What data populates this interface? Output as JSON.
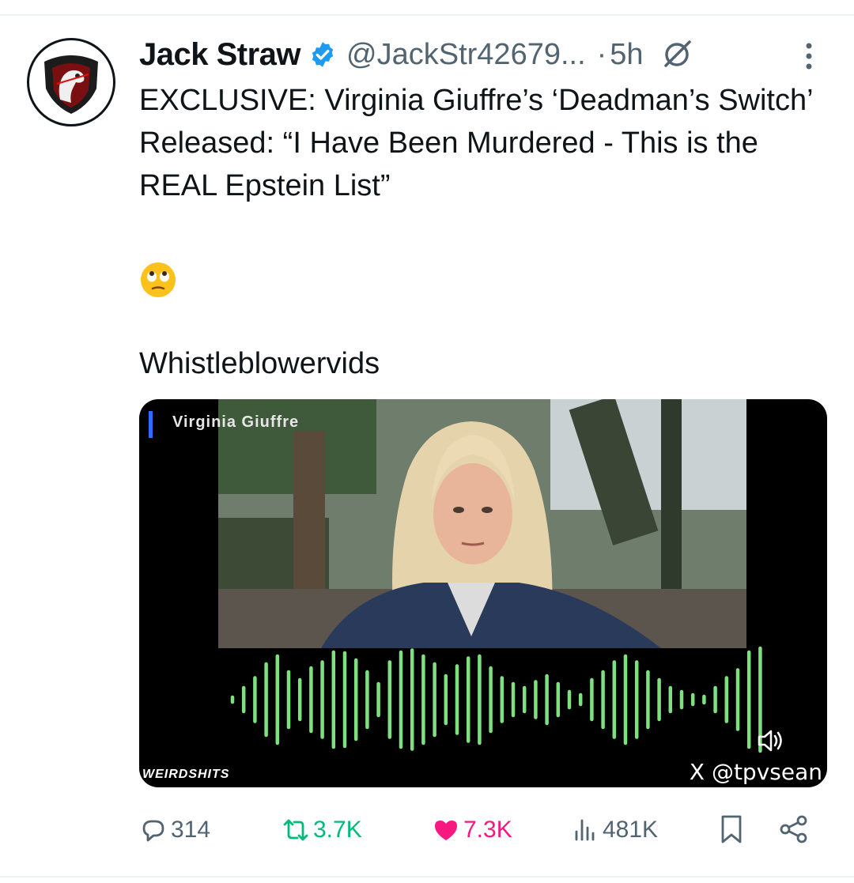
{
  "post": {
    "author_name": "Jack Straw",
    "author_handle": "@JackStr42679...",
    "separator": "·",
    "time_ago": "5h",
    "text": "EXCLUSIVE: Virginia Giuffre’s ‘Deadman’s Switch’ Released: “I Have Been Murdered - This is the REAL Epstein List”",
    "emoji": "face-with-rolling-eyes",
    "source_label": "Whistleblowervids"
  },
  "media": {
    "caption": "Virginia Giuffre",
    "watermark_left": "WEIRDSHITS",
    "watermark_right": "X @tpvsean",
    "waveform_color": "#7ee07e"
  },
  "actions": {
    "replies": "314",
    "reposts": "3.7K",
    "likes": "7.3K",
    "views": "481K"
  },
  "colors": {
    "verified": "#1d9bf0",
    "repost": "#00ba7c",
    "like": "#f91880",
    "muted": "#536471"
  }
}
